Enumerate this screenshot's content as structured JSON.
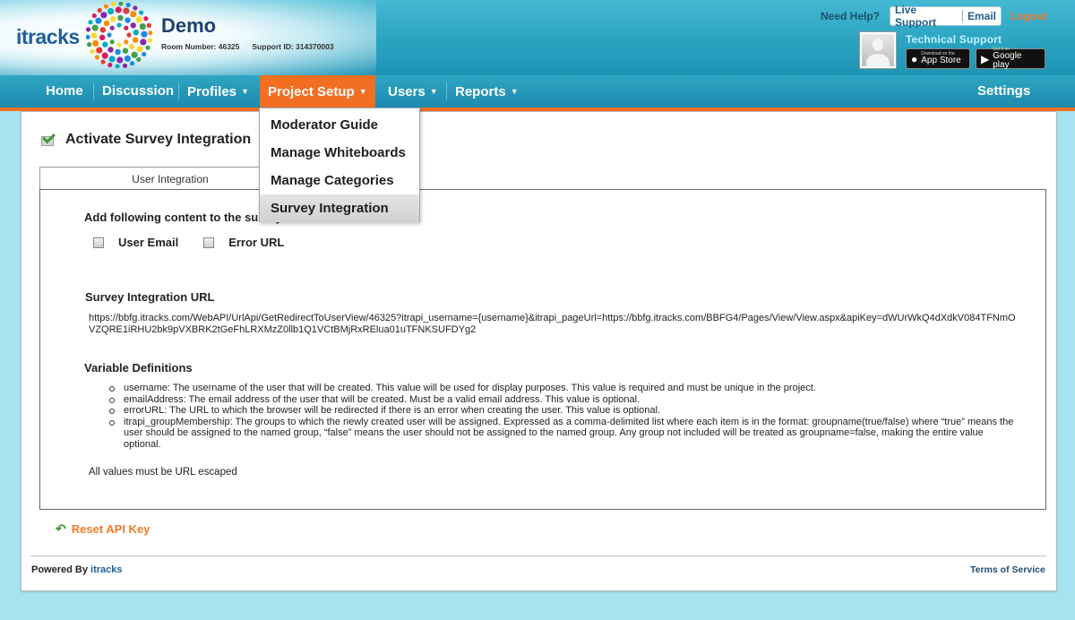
{
  "header": {
    "logo_text": "itracks",
    "project_name": "Demo",
    "room_number": "Room Number: 46325",
    "support_id": "Support ID: 314370003",
    "help_label": "Need Help?",
    "live_support": "Live Support",
    "email": "Email",
    "logout": "Logout",
    "tech_support": "Technical Support",
    "app_store": {
      "small": "Download on the",
      "big": "App Store"
    },
    "google_play": {
      "small": "Get it on",
      "big": "Google play"
    }
  },
  "nav": {
    "home": "Home",
    "discussion": "Discussion",
    "profiles": "Profiles",
    "project_setup": "Project Setup",
    "users": "Users",
    "reports": "Reports",
    "settings": "Settings",
    "caret": "▼"
  },
  "dropdown": {
    "items": [
      "Moderator Guide",
      "Manage Whiteboards",
      "Manage Categories",
      "Survey Integration"
    ],
    "selected": "Survey Integration"
  },
  "page": {
    "title": "Activate Survey Integration",
    "tab": "User Integration",
    "instruction": "Add following content to the survey:",
    "options": [
      "User Email",
      "Error URL"
    ],
    "url_heading": "Survey Integration URL",
    "url_value": "https://bbfg.itracks.com/WebAPI/UrlApi/GetRedirectToUserView/46325?itrapi_username={username}&itrapi_pageUrl=https://bbfg.itracks.com/BBFG4/Pages/View/View.aspx&apiKey=dWUrWkQ4dXdkV084TFNmOVZQRE1iRHU2bk9pVXBRK2tGeFhLRXMzZ0llb1Q1VCtBMjRxRElua01uTFNKSUFDYg2",
    "vars_heading": "Variable Definitions",
    "variables": [
      "username: The username of the user that will be created. This value will be used for display purposes. This value is required and must be unique in the project.",
      "emailAddress: The email address of the user that will be created. Must be a valid email address. This value is optional.",
      "errorURL: The URL to which the browser will be redirected if there is an error when creating the user. This value is optional.",
      "itrapi_groupMembership: The groups to which the newly created user will be assigned. Expressed as a comma-delimited list where each item is in the format: groupname(true/false) where “true” means the user should be assigned to the named group, “false” means the user should not be assigned to the named group. Any group not included will be treated as groupname=false, making the entire value optional."
    ],
    "escape_note": "All values must be URL escaped",
    "reset_label": "Reset API Key"
  },
  "footer": {
    "powered_by": "Powered By",
    "brand": "itracks",
    "terms": "Terms of Service"
  },
  "colors": {
    "accent_orange": "#f26f21",
    "nav_blue": "#1c8aad",
    "link_blue": "#1e5e9a",
    "background": "#a6e3f0"
  },
  "icons": {
    "logo": "itracks-burst-logo",
    "avatar": "user-avatar-icon",
    "title_check": "check-icon",
    "reset": "undo-arrow-icon"
  }
}
